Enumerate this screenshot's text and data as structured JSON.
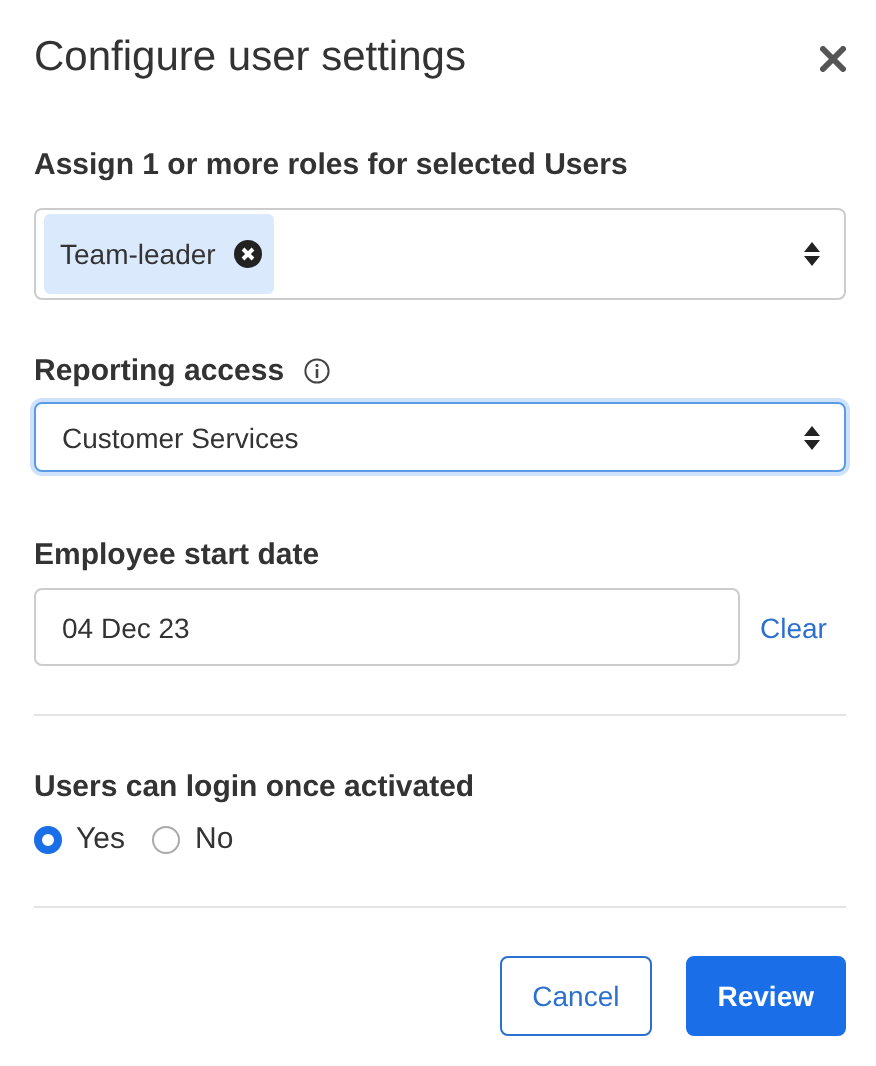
{
  "dialog": {
    "title": "Configure user settings"
  },
  "roles": {
    "label": "Assign 1 or more roles for selected Users",
    "chips": [
      {
        "label": "Team-leader"
      }
    ]
  },
  "reporting": {
    "label": "Reporting access",
    "value": "Customer Services",
    "focused": true
  },
  "start_date": {
    "label": "Employee start date",
    "value": "04 Dec 23",
    "clear": "Clear"
  },
  "login": {
    "label": "Users can login once activated",
    "options": [
      {
        "label": "Yes",
        "selected": true
      },
      {
        "label": "No",
        "selected": false
      }
    ]
  },
  "buttons": [
    {
      "label": "Cancel",
      "kind": "secondary"
    },
    {
      "label": "Review",
      "kind": "primary"
    }
  ]
}
